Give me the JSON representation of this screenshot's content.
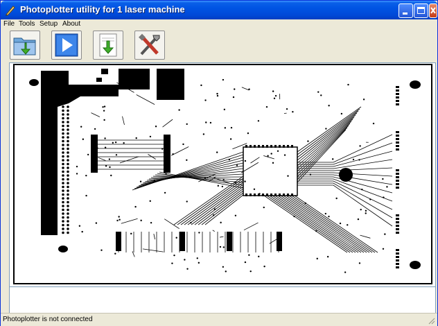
{
  "window": {
    "title": "Photoplotter utility for 1 laser machine"
  },
  "menu": [
    {
      "label": "File"
    },
    {
      "label": "Tools"
    },
    {
      "label": "Setup"
    },
    {
      "label": "About"
    }
  ],
  "toolbar": {
    "buttons": [
      {
        "icon": "open-folder-icon"
      },
      {
        "icon": "play-icon"
      },
      {
        "icon": "download-document-icon"
      },
      {
        "icon": "tools-icon"
      }
    ]
  },
  "status": {
    "text": "Photoplotter is not connected"
  },
  "colors": {
    "titlebar": "#0054e3",
    "chrome": "#ece9d8",
    "board_ink": "#000000"
  }
}
